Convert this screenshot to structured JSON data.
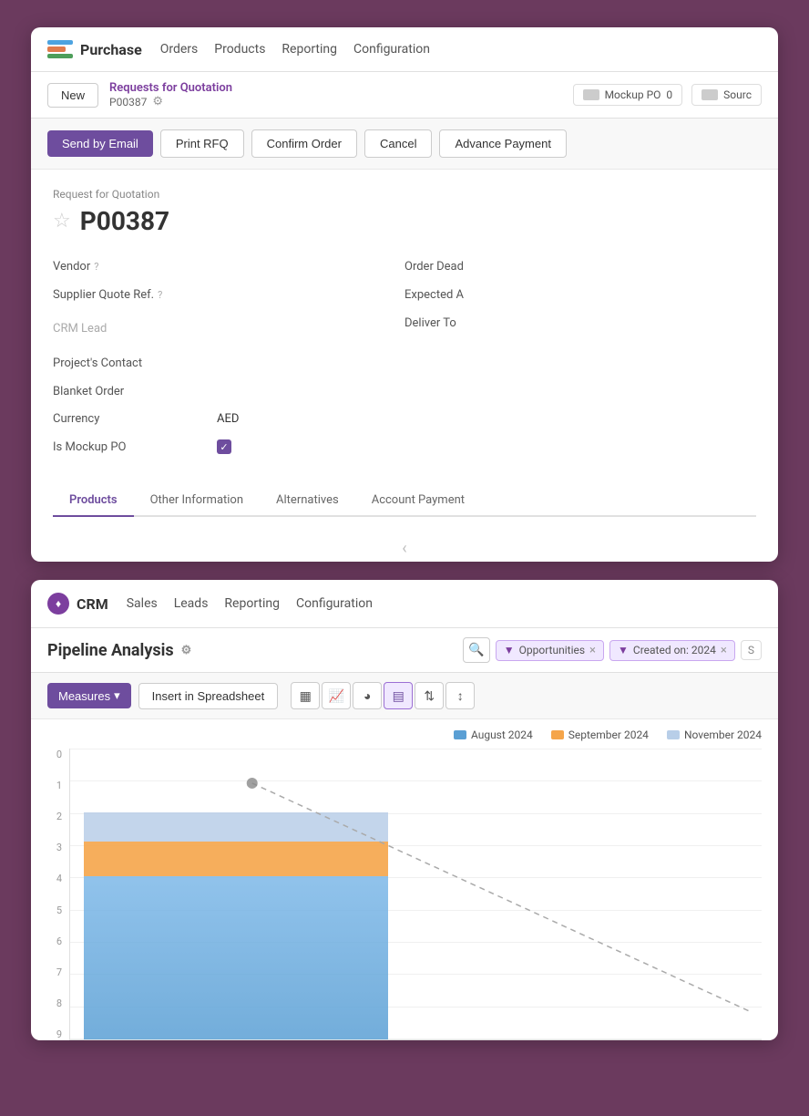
{
  "purchase": {
    "brand": "Purchase",
    "nav": [
      "Orders",
      "Products",
      "Reporting",
      "Configuration"
    ],
    "new_btn": "New",
    "breadcrumb": "Requests for Quotation",
    "record_id": "P00387",
    "mockup_po_label": "Mockup PO",
    "mockup_po_value": "0",
    "source_label": "Sourc",
    "actions": [
      "Send by Email",
      "Print RFQ",
      "Confirm Order",
      "Cancel",
      "Advance Payment"
    ],
    "form": {
      "type_label": "Request for Quotation",
      "title": "P00387",
      "vendor_label": "Vendor",
      "vendor_help": "?",
      "order_deadline_label": "Order Dead",
      "supplier_quote_label": "Supplier Quote Ref.",
      "supplier_quote_help": "?",
      "expected_arrival_label": "Expected A",
      "crm_lead_label": "CRM Lead",
      "projects_contact_label": "Project's Contact",
      "deliver_to_label": "Deliver To",
      "blanket_order_label": "Blanket Order",
      "currency_label": "Currency",
      "currency_value": "AED",
      "is_mockup_label": "Is Mockup PO",
      "is_mockup_checked": true
    },
    "tabs": [
      "Products",
      "Other Information",
      "Alternatives",
      "Account Payment"
    ],
    "active_tab": "Products"
  },
  "crm": {
    "brand": "CRM",
    "nav": [
      "Sales",
      "Leads",
      "Reporting",
      "Configuration"
    ],
    "page_title": "Pipeline Analysis",
    "filters": {
      "opportunities_label": "Opportunities",
      "created_on_label": "Created on: 2024",
      "more_label": "S"
    },
    "measures_btn": "Measures",
    "insert_btn": "Insert in Spreadsheet",
    "chart_types": [
      "bar",
      "line",
      "pie",
      "stacked",
      "sort-asc",
      "sort-desc"
    ],
    "active_chart": "stacked",
    "legend": [
      {
        "label": "August 2024",
        "color": "#5a9fd4"
      },
      {
        "label": "September 2024",
        "color": "#f5a54a"
      },
      {
        "label": "November 2024",
        "color": "#b8cee8"
      }
    ],
    "y_axis": [
      "0",
      "1",
      "2",
      "3",
      "4",
      "5",
      "6",
      "7",
      "8",
      "9"
    ],
    "chart_icons": {
      "bar": "▦",
      "line": "〰",
      "pie": "◕",
      "stacked": "▤",
      "sort_asc": "⇅",
      "sort_desc": "↕"
    }
  }
}
